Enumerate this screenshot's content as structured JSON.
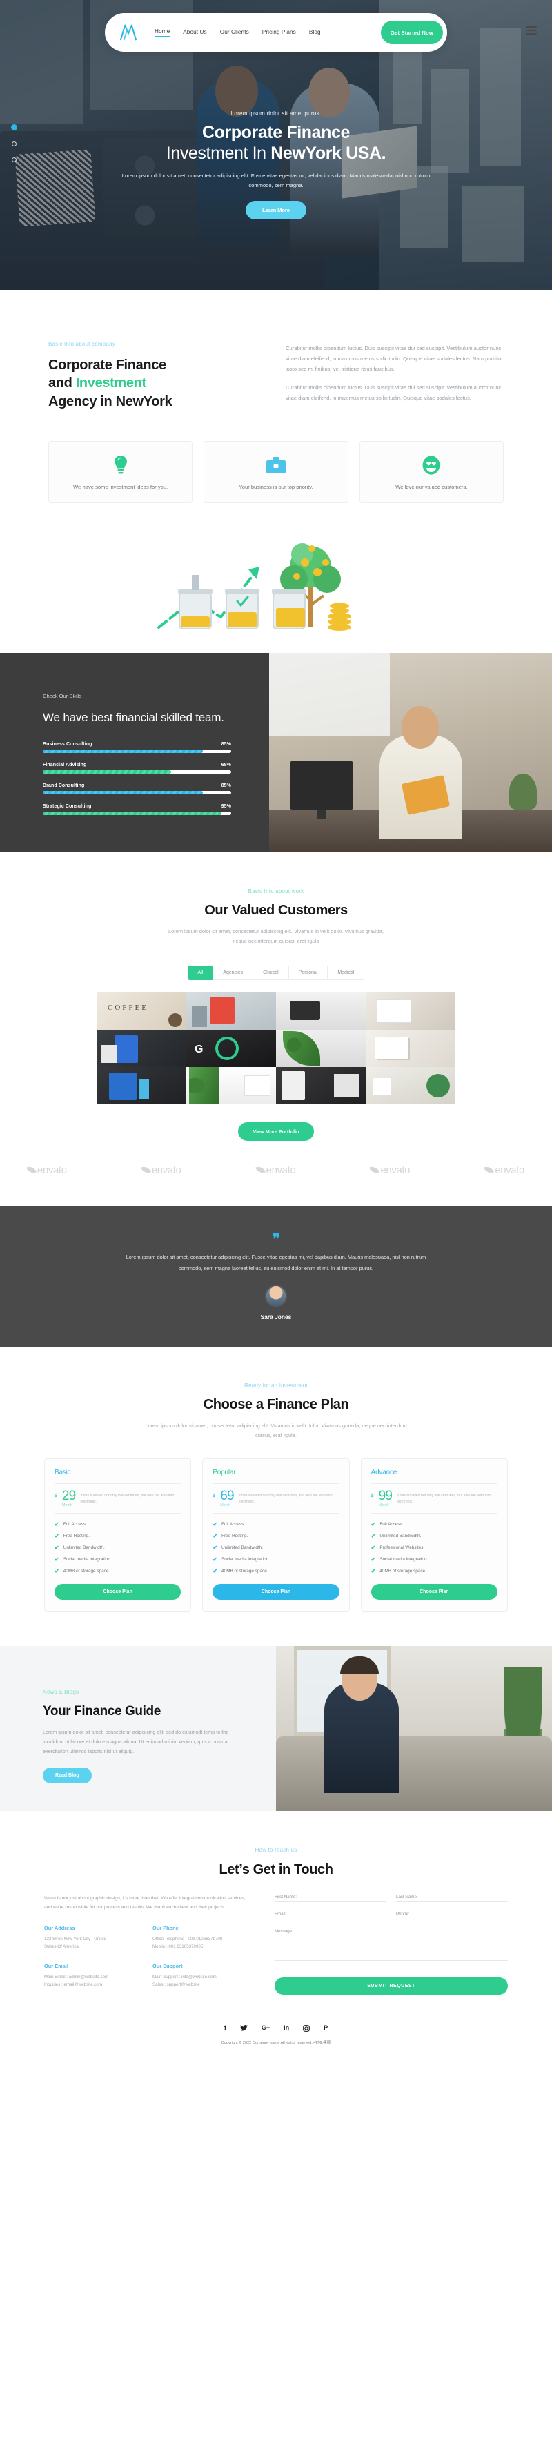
{
  "nav": {
    "logo_icon": "m-logo-icon",
    "links": [
      {
        "label": "Home",
        "active": true
      },
      {
        "label": "About Us",
        "active": false
      },
      {
        "label": "Our Clients",
        "active": false
      },
      {
        "label": "Pricing Plans",
        "active": false
      },
      {
        "label": "Blog",
        "active": false
      }
    ],
    "cta": "Get Started Now",
    "menu_icon": "hamburger-menu-icon"
  },
  "hero": {
    "kicker": "Lorem ipsum dolor sit amet purus.",
    "title_line1": "Corporate Finance",
    "title_line2_light": "Investment In ",
    "title_line2_bold": "NewYork USA.",
    "subtitle": "Lorem ipsum dolor sit amet, consectetur adipiscing elit. Fusce vitae egestas mi, vel dapibus diam. Mauris malesuada, nisl non rutrum commodo, sem magna.",
    "button": "Learn More"
  },
  "about": {
    "kicker": "Basic Info about company",
    "title_1": "Corporate Finance",
    "title_2_plain": "and ",
    "title_2_accent": "Investment",
    "title_3": "Agency in NewYork",
    "paragraph_1": "Curabitur mollis bibendum luctus. Duis suscipit vitae dui sed suscipit. Vestibulum auctor nunc vitae diam eleifend, in maximus metus sollicitudin. Quisque vitae sodales lectus. Nam porttitor justo sed mi finibus, vel tristique risus faucibus.",
    "paragraph_2": "Curabitur mollis bibendum luctus. Duis suscipit vitae dui sed suscipit. Vestibulum auctor nunc vitae diam eleifend, in maximus metus sollicitudin. Quisque vitae sodales lectus."
  },
  "features": [
    {
      "icon": "lightbulb-icon",
      "text": "We have some investment ideas for you.",
      "color": "#2ecc8f"
    },
    {
      "icon": "briefcase-icon",
      "text": "Your business is our top priority.",
      "color": "#4cc3ea"
    },
    {
      "icon": "smiley-heart-eyes-icon",
      "text": "We love our valued customers.",
      "color": "#2ecc8f"
    }
  ],
  "skills": {
    "kicker": "Check Our Skills",
    "title": "We have best financial skilled team.",
    "bars": [
      {
        "label": "Business Consulting",
        "value": 85,
        "value_label": "85%",
        "color": "blue"
      },
      {
        "label": "Financial Advising",
        "value": 68,
        "value_label": "68%",
        "color": "green"
      },
      {
        "label": "Brand Consulting",
        "value": 85,
        "value_label": "85%",
        "color": "blue"
      },
      {
        "label": "Strategic Consulting",
        "value": 95,
        "value_label": "95%",
        "color": "green"
      }
    ]
  },
  "portfolio": {
    "kicker": "Basic Info about work",
    "title": "Our Valued Customers",
    "desc": "Lorem ipsum dolor sit amet, consectetur adipiscing elit. Vivamus in velit dolor. Vivamus gravida, neque nec interdum cursus, erat ligula",
    "filters": [
      {
        "label": "All",
        "active": true
      },
      {
        "label": "Agencies",
        "active": false
      },
      {
        "label": "Clinical",
        "active": false
      },
      {
        "label": "Personal",
        "active": false
      },
      {
        "label": "Medical",
        "active": false
      }
    ],
    "button": "View More Portfolio",
    "logos": [
      "envato",
      "envato",
      "envato",
      "envato",
      "envato",
      "envato"
    ]
  },
  "testimonial": {
    "quote_icon": "quote-mark-icon",
    "text": "Lorem ipsum dolor sit amet, consectetur adipiscing elit. Fusce vitae egestas mi, vel dapibus diam. Mauris malesuada, nisl non rutrum commodo, sem magna laoreet tellus, eu euismod dolor enim et mi. In at tempor purus.",
    "author": "Sara Jones"
  },
  "pricing": {
    "kicker": "Ready for an Investment",
    "title": "Choose a Finance Plan",
    "desc": "Lorem ipsum dolor sit amet, consectetur adipiscing elit. Vivamus in velit dolor. Vivamus gravida, neque nec interdum cursus, erat ligula.",
    "plans": [
      {
        "name": "Basic",
        "currency": "$",
        "amount": "29",
        "period": "Month",
        "note": "It has survived not only five centuries, but also the leap into electronic.",
        "features": [
          "Full Access.",
          "Free Hosting.",
          "Unlimited Bandwidth.",
          "Social media integration.",
          "40MB of storage space."
        ],
        "button": "Choose Plan",
        "theme": "g"
      },
      {
        "name": "Popular",
        "currency": "$",
        "amount": "69",
        "period": "Month",
        "note": "It has survived not only five centuries, but also the leap into electronic.",
        "features": [
          "Full Access.",
          "Free Hosting.",
          "Unlimited Bandwidth.",
          "Social media integration.",
          "40MB of storage space."
        ],
        "button": "Choose Plan",
        "theme": "b"
      },
      {
        "name": "Advance",
        "currency": "$",
        "amount": "99",
        "period": "Month",
        "note": "It has survived not only five centuries, but also the leap into electronic.",
        "features": [
          "Full Access.",
          "Unlimited Bandwidth.",
          "Professional Websites.",
          "Social media integration.",
          "40MB of storage space."
        ],
        "button": "Choose Plan",
        "theme": "g"
      }
    ]
  },
  "blog": {
    "kicker": "News & Blogs",
    "title": "Your Finance Guide",
    "paragraph": "Lorem ipsum dolor sit amet, consectetur adipisicing elit, sed do eiusmodt temp to the incididunt ut labore et dolore magna aliqua. Ut enim ad minim veniam, quis a nostr a exercitation ullamco laboris nisi ut aliquip.",
    "button": "Read Blog"
  },
  "contact": {
    "kicker": "How to reach us",
    "title": "Let’s Get in Touch",
    "intro": "Wrest is not just about graphic design, it’s more than that. We offer integral communication services, and we’re responsible for our process and results. We thank each client and their projects.",
    "blocks": [
      {
        "title": "Our Address",
        "lines": [
          "123 Stree New York City , United",
          "States Of America."
        ]
      },
      {
        "title": "Our Phone",
        "lines": [
          "Office Telephone : 001 01066379708",
          "Mobile : 001 63165370905"
        ]
      },
      {
        "title": "Our Email",
        "lines": [
          "Main Email : admin@website.com",
          "Inquiries : email@website.com"
        ]
      },
      {
        "title": "Our Support",
        "lines": [
          "Main Support : info@website.com",
          "Sales : support@website"
        ]
      }
    ],
    "form": {
      "first_name": "First Name:",
      "last_name": "Last Name:",
      "email": "Email:",
      "phone": "Phone:",
      "message": "Message",
      "submit": "SUBMIT REQUEST"
    }
  },
  "footer": {
    "socials": [
      {
        "icon": "facebook-icon",
        "glyph": "f"
      },
      {
        "icon": "twitter-icon",
        "glyph": "✉"
      },
      {
        "icon": "google-plus-icon",
        "glyph": "G+"
      },
      {
        "icon": "linkedin-icon",
        "glyph": "in"
      },
      {
        "icon": "instagram-icon",
        "glyph": "□"
      },
      {
        "icon": "pinterest-icon",
        "glyph": "P"
      }
    ],
    "copyright": "Copyright © 2022 Company name All rights reserved.HTML模版"
  },
  "colors": {
    "green": "#2ecc8f",
    "blue": "#2bb7e8",
    "sky": "#5bd3f0",
    "dark": "#3d3d3d"
  }
}
